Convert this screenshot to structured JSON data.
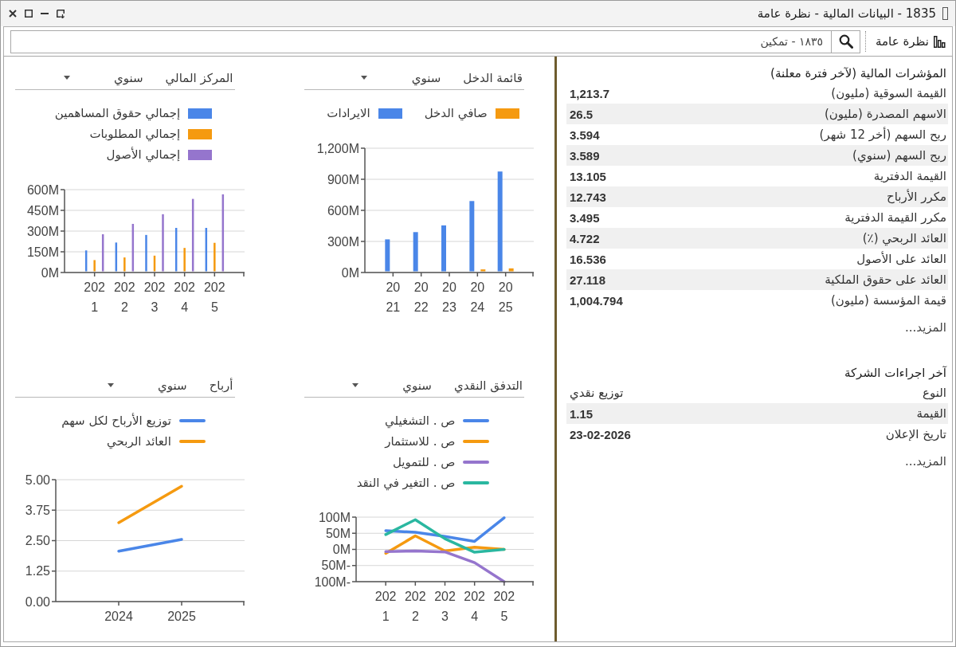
{
  "window": {
    "title": "1835 - البيانات المالية - نظرة عامة"
  },
  "toolbar": {
    "view_button": "نظرة عامة",
    "search": {
      "value": "١٨٣٥ - تمكين"
    }
  },
  "panels": [
    {
      "title": "المؤشرات المالية (لآخر فترة معلنة)",
      "rows": [
        {
          "label": "القيمة السوقية (مليون)",
          "value": "1,213.7"
        },
        {
          "label": "الاسهم المصدرة (مليون)",
          "value": "26.5"
        },
        {
          "label": "ربح السهم (أخر 12 شهر)",
          "value": "3.594"
        },
        {
          "label": "ربح السهم (سنوي)",
          "value": "3.589"
        },
        {
          "label": "القيمة الدفترية",
          "value": "13.105"
        },
        {
          "label": "مكرر الأرباح",
          "value": "12.743"
        },
        {
          "label": "مكرر القيمة الدفترية",
          "value": "3.495"
        },
        {
          "label": "العائد الربحي (٪)",
          "value": "4.722"
        },
        {
          "label": "العائد على الأصول",
          "value": "16.536"
        },
        {
          "label": "العائد على حقوق الملكية",
          "value": "27.118"
        },
        {
          "label": "قيمة المؤسسة (مليون)",
          "value": "1,004.794"
        }
      ],
      "more_link": "المزيد..."
    },
    {
      "title": "آخر اجراءات الشركة",
      "rows": [
        {
          "label": "النوع",
          "value": "توزيع نقدي",
          "kind": "text"
        },
        {
          "label": "القيمة",
          "value": "1.15",
          "kind": "number"
        },
        {
          "label": "تاريخ الإعلان",
          "value": "23-02-2026",
          "kind": "date"
        }
      ],
      "more_link": "المزيد..."
    }
  ],
  "charts": [
    {
      "period": "سنوي",
      "chart_data": {
        "type": "bar",
        "title": "قائمة الدخل",
        "categories": [
          "2021",
          "2022",
          "2023",
          "2024",
          "2025"
        ],
        "series": [
          {
            "name": "الايرادات",
            "color": "#4a86e8",
            "values": [
              320,
              390,
              455,
              690,
              975
            ]
          },
          {
            "name": "صافي الدخل",
            "color": "#f59a10",
            "values": [
              null,
              null,
              null,
              30,
              40
            ]
          }
        ],
        "ylim": [
          0,
          1200
        ],
        "yticks": [
          {
            "value": 0,
            "label": "0M"
          },
          {
            "value": 300,
            "label": "300M"
          },
          {
            "value": 600,
            "label": "600M"
          },
          {
            "value": 900,
            "label": "900M"
          },
          {
            "value": 1200,
            "label": "1,200M"
          }
        ],
        "grid": true
      }
    },
    {
      "period": "سنوي",
      "chart_data": {
        "type": "bar",
        "title": "المركز المالي",
        "categories": [
          "2021",
          "2022",
          "2023",
          "2024",
          "2025"
        ],
        "series": [
          {
            "name": "إجمالي حقوق المساهمين",
            "color": "#4a86e8",
            "values": [
              160,
              217,
              272,
              323,
              323
            ]
          },
          {
            "name": "إجمالي المطلوبات",
            "color": "#f59a10",
            "values": [
              90,
              109,
              122,
              178,
              215
            ]
          },
          {
            "name": "إجمالي الأصول",
            "color": "#9575cd",
            "values": [
              277,
              352,
              422,
              533,
              566
            ]
          }
        ],
        "ylim": [
          0,
          600
        ],
        "yticks": [
          {
            "value": 0,
            "label": "0M"
          },
          {
            "value": 150,
            "label": "150M"
          },
          {
            "value": 300,
            "label": "300M"
          },
          {
            "value": 450,
            "label": "450M"
          },
          {
            "value": 600,
            "label": "600M"
          }
        ],
        "grid": true
      }
    },
    {
      "period": "سنوي",
      "chart_data": {
        "type": "line",
        "title": "التدفق النقدي",
        "categories": [
          "2021",
          "2022",
          "2023",
          "2024",
          "2025"
        ],
        "series": [
          {
            "name": "ص . التشغيلي",
            "color": "#4a86e8",
            "values": [
              58,
              53,
              40,
              25,
              98
            ]
          },
          {
            "name": "ص . للاستثمار",
            "color": "#f59a10",
            "values": [
              -12,
              42,
              -5,
              7,
              0
            ]
          },
          {
            "name": "ص . للتمويل",
            "color": "#9575cd",
            "values": [
              -7,
              -5,
              -8,
              -41,
              -100
            ]
          },
          {
            "name": "ص . التغير في النقد",
            "color": "#2ab7a0",
            "values": [
              46,
              92,
              33,
              -9,
              0
            ]
          }
        ],
        "ylim": [
          -100,
          100
        ],
        "yticks": [
          {
            "value": -100,
            "label": "-100M"
          },
          {
            "value": -50,
            "label": "-50M"
          },
          {
            "value": 0,
            "label": "0M"
          },
          {
            "value": 50,
            "label": "50M"
          },
          {
            "value": 100,
            "label": "100M"
          }
        ],
        "grid": true
      }
    },
    {
      "period": "سنوي",
      "chart_data": {
        "type": "line",
        "title": "أرباح",
        "categories": [
          "2024",
          "2025"
        ],
        "series": [
          {
            "name": "توزيع الأرباح لكل سهم",
            "color": "#4a86e8",
            "values": [
              2.07,
              2.55
            ]
          },
          {
            "name": "العائد الربحي",
            "color": "#f59a10",
            "values": [
              3.24,
              4.73
            ]
          }
        ],
        "ylim": [
          0,
          5
        ],
        "yticks": [
          {
            "value": 0,
            "label": "0.00"
          },
          {
            "value": 1.25,
            "label": "1.25"
          },
          {
            "value": 2.5,
            "label": "2.50"
          },
          {
            "value": 3.75,
            "label": "3.75"
          },
          {
            "value": 5,
            "label": "5.00"
          }
        ],
        "grid": true
      }
    }
  ]
}
